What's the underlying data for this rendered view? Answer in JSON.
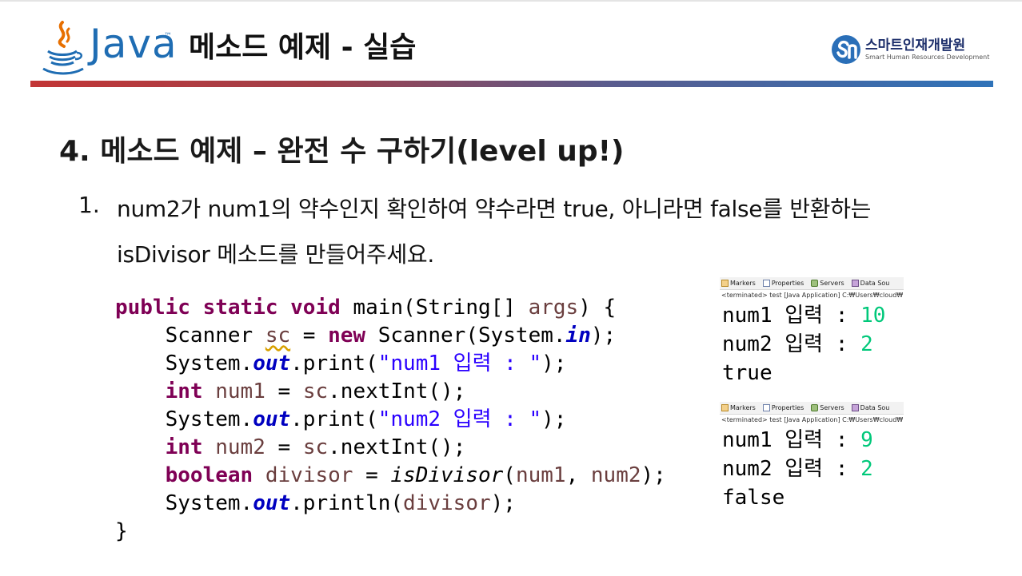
{
  "header": {
    "java_text": "Java",
    "tm": "™",
    "title": "메소드 예제 - 실습",
    "brand_name": "스마트인재개발원",
    "brand_sub": "Smart Human Resources Development"
  },
  "colors": {
    "java_blue": "#1f6db3",
    "bar_start": "#c23636",
    "bar_end": "#2f73b9",
    "keyword": "#7f0055",
    "string": "#2a00ff",
    "field": "#0000c0",
    "console_input": "#00c87a"
  },
  "section_title": "4. 메소드 예제 – 완전 수 구하기(level up!)",
  "item": {
    "number": "1.",
    "line1": "num2가 num1의 약수인지 확인하여 약수라면 true, 아니라면 false를 반환하는",
    "line2": "isDivisor 메소드를 만들어주세요."
  },
  "code": {
    "l1_kw1": "public",
    "l1_kw2": "static",
    "l1_kw3": "void",
    "l1_a": " main(String[] ",
    "l1_var": "args",
    "l1_b": ") {",
    "l2_a": "    Scanner ",
    "l2_var": "sc",
    "l2_b": " = ",
    "l2_kw": "new",
    "l2_c": " Scanner(System.",
    "l2_fld": "in",
    "l2_d": ");",
    "l3_a": "    System.",
    "l3_fld": "out",
    "l3_b": ".print(",
    "l3_str": "\"num1 입력 : \"",
    "l3_c": ");",
    "l4_kw": "int",
    "l4_var": "num1",
    "l4_a": " = ",
    "l4_var2": "sc",
    "l4_b": ".nextInt();",
    "l5_a": "    System.",
    "l5_fld": "out",
    "l5_b": ".print(",
    "l5_str": "\"num2 입력 : \"",
    "l5_c": ");",
    "l6_kw": "int",
    "l6_var": "num2",
    "l6_a": " = ",
    "l6_var2": "sc",
    "l6_b": ".nextInt();",
    "l7_kw": "boolean",
    "l7_var": "divisor",
    "l7_a": " = ",
    "l7_call": "isDivisor",
    "l7_b": "(",
    "l7_var2": "num1",
    "l7_c": ", ",
    "l7_var3": "num2",
    "l7_d": ");",
    "l8_a": "    System.",
    "l8_fld": "out",
    "l8_b": ".println(",
    "l8_var": "divisor",
    "l8_c": ");",
    "l9": "}"
  },
  "consoles": [
    {
      "tabs": [
        "Markers",
        "Properties",
        "Servers",
        "Data Sou"
      ],
      "status": "<terminated> test [Java Application] C:₩Users₩cloud₩",
      "line1_label": "num1 입력 : ",
      "line1_value": "10",
      "line2_label": "num2 입력 : ",
      "line2_value": "2",
      "result": "true"
    },
    {
      "tabs": [
        "Markers",
        "Properties",
        "Servers",
        "Data Sou"
      ],
      "status": "<terminated> test [Java Application] C:₩Users₩cloud₩",
      "line1_label": "num1 입력 : ",
      "line1_value": "9",
      "line2_label": "num2 입력 : ",
      "line2_value": "2",
      "result": "false"
    }
  ]
}
